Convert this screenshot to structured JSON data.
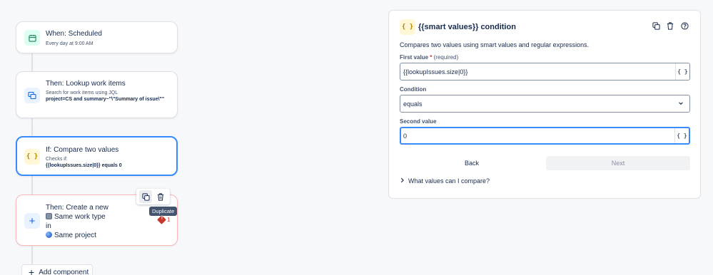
{
  "flow": {
    "trigger": {
      "title": "When: Scheduled",
      "subtitle": "Every day at 9:00 AM"
    },
    "lookup": {
      "title": "Then: Lookup work items",
      "subtitle": "Search for work items using JQL",
      "query": "project=CS and summary~\"\\\"Summary of issue\\\"\""
    },
    "condition": {
      "title": "If: Compare two values",
      "subtitle": "Checks if:",
      "expression": "{{lookupIssues.size|0}} equals 0"
    },
    "create": {
      "title_line1": "Then: Create a new",
      "type_label": "Same work type",
      "in_label": "in",
      "project_label": "Same project",
      "error_count": "1"
    },
    "tooltip": "Duplicate",
    "add_component": "Add component"
  },
  "panel": {
    "title": "{{smart values}} condition",
    "description": "Compares two values using smart values and regular expressions.",
    "first_value": {
      "label": "First value",
      "required_star": "*",
      "required_text": "(required)",
      "value": "{{lookupIssues.size|0}}"
    },
    "condition": {
      "label": "Condition",
      "value": "equals"
    },
    "second_value": {
      "label": "Second value",
      "value": "0"
    },
    "smart_value_glyph": "{ }",
    "back_label": "Back",
    "next_label": "Next",
    "help_expander": "What values can I compare?"
  },
  "icons": {
    "condition_glyph": "{ }",
    "add_glyph": "+"
  },
  "colors": {
    "accent_blue": "#388bff",
    "error_red": "#c9372c",
    "condition_yellow": "#fff7d6"
  }
}
